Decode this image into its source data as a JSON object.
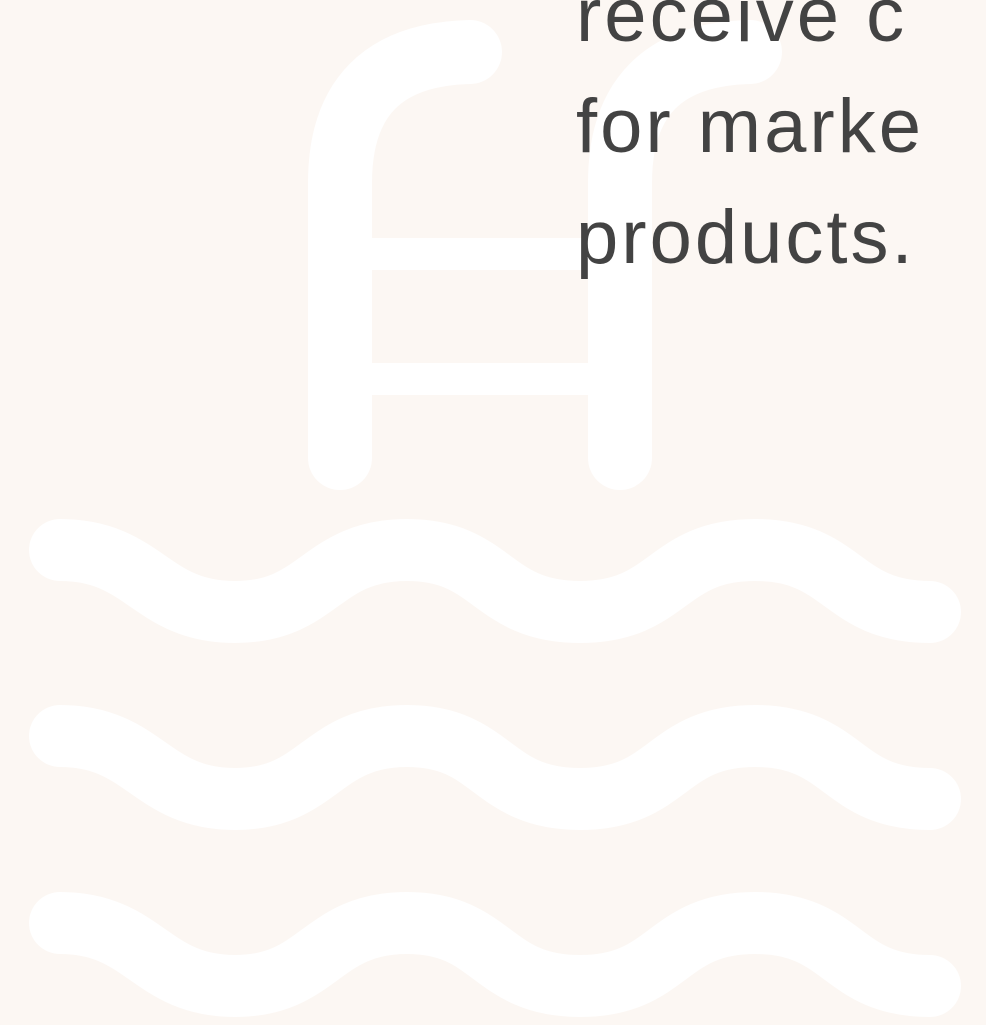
{
  "background": {
    "color": "#fcf7f3",
    "icon_color": "#ffffff",
    "icon": "swimming-pool-ladder-icon"
  },
  "text": {
    "color": "#434343",
    "lines": [
      "receive c",
      "for marke",
      "products."
    ]
  }
}
